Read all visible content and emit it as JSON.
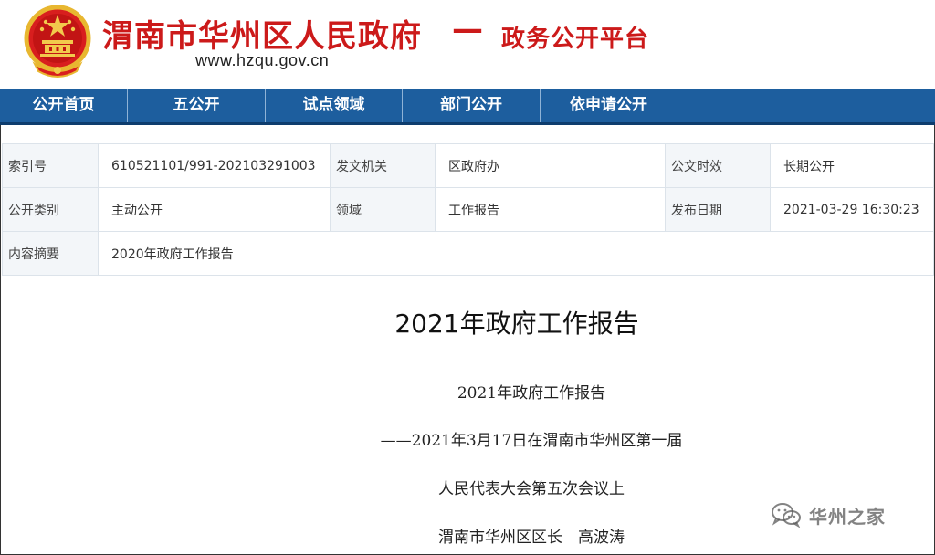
{
  "header": {
    "site_name": "渭南市华州区人民政府",
    "dash": "—",
    "platform_name": "政务公开平台",
    "url": "www.hzqu.gov.cn",
    "emblem_icon": "national-emblem-icon"
  },
  "nav": {
    "items": [
      {
        "label": "公开首页"
      },
      {
        "label": "五公开"
      },
      {
        "label": "试点领域"
      },
      {
        "label": "部门公开"
      },
      {
        "label": "依申请公开"
      }
    ]
  },
  "info": {
    "index_label": "索引号",
    "index_value": "610521101/991-202103291003",
    "issuer_label": "发文机关",
    "issuer_value": "区政府办",
    "validity_label": "公文时效",
    "validity_value": "长期公开",
    "category_label": "公开类别",
    "category_value": "主动公开",
    "domain_label": "领域",
    "domain_value": "工作报告",
    "date_label": "发布日期",
    "date_value": "2021-03-29 16:30:23",
    "summary_label": "内容摘要",
    "summary_value": "2020年政府工作报告"
  },
  "article": {
    "title": "2021年政府工作报告",
    "lines": [
      "2021年政府工作报告",
      "——2021年3月17日在渭南市华州区第一届",
      "人民代表大会第五次会议上",
      "渭南市华州区区长　高波涛"
    ]
  },
  "watermark": {
    "text": "华州之家",
    "icon": "wechat-icon"
  },
  "colors": {
    "brand_red": "#cc1a1a",
    "nav_blue": "#1d5e9e",
    "emblem_gold": "#f2c94c"
  }
}
